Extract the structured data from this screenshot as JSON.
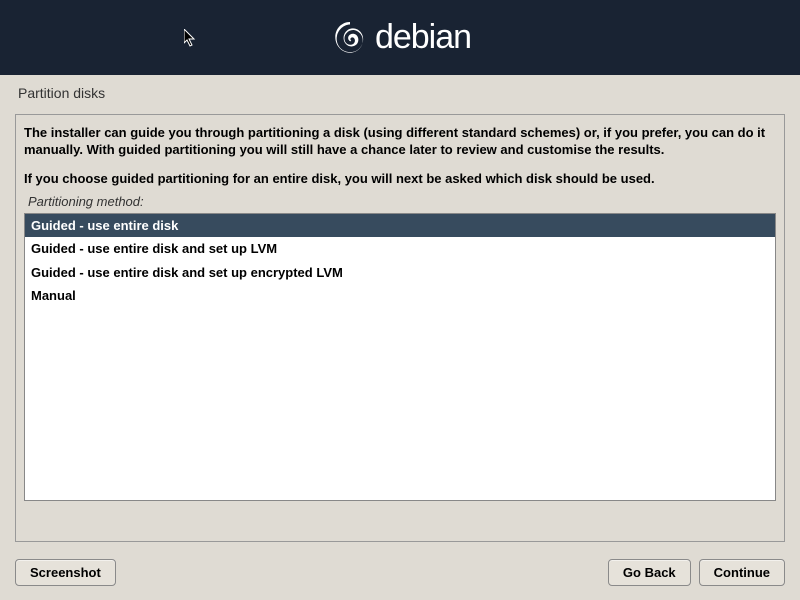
{
  "header": {
    "logo_text": "debian"
  },
  "page": {
    "title": "Partition disks",
    "description_1": "The installer can guide you through partitioning a disk (using different standard schemes) or, if you prefer, you can do it manually. With guided partitioning you will still have a chance later to review and customise the results.",
    "description_2": "If you choose guided partitioning for an entire disk, you will next be asked which disk should be used.",
    "method_label": "Partitioning method:"
  },
  "options": [
    "Guided - use entire disk",
    "Guided - use entire disk and set up LVM",
    "Guided - use entire disk and set up encrypted LVM",
    "Manual"
  ],
  "buttons": {
    "screenshot": "Screenshot",
    "go_back": "Go Back",
    "continue": "Continue"
  }
}
